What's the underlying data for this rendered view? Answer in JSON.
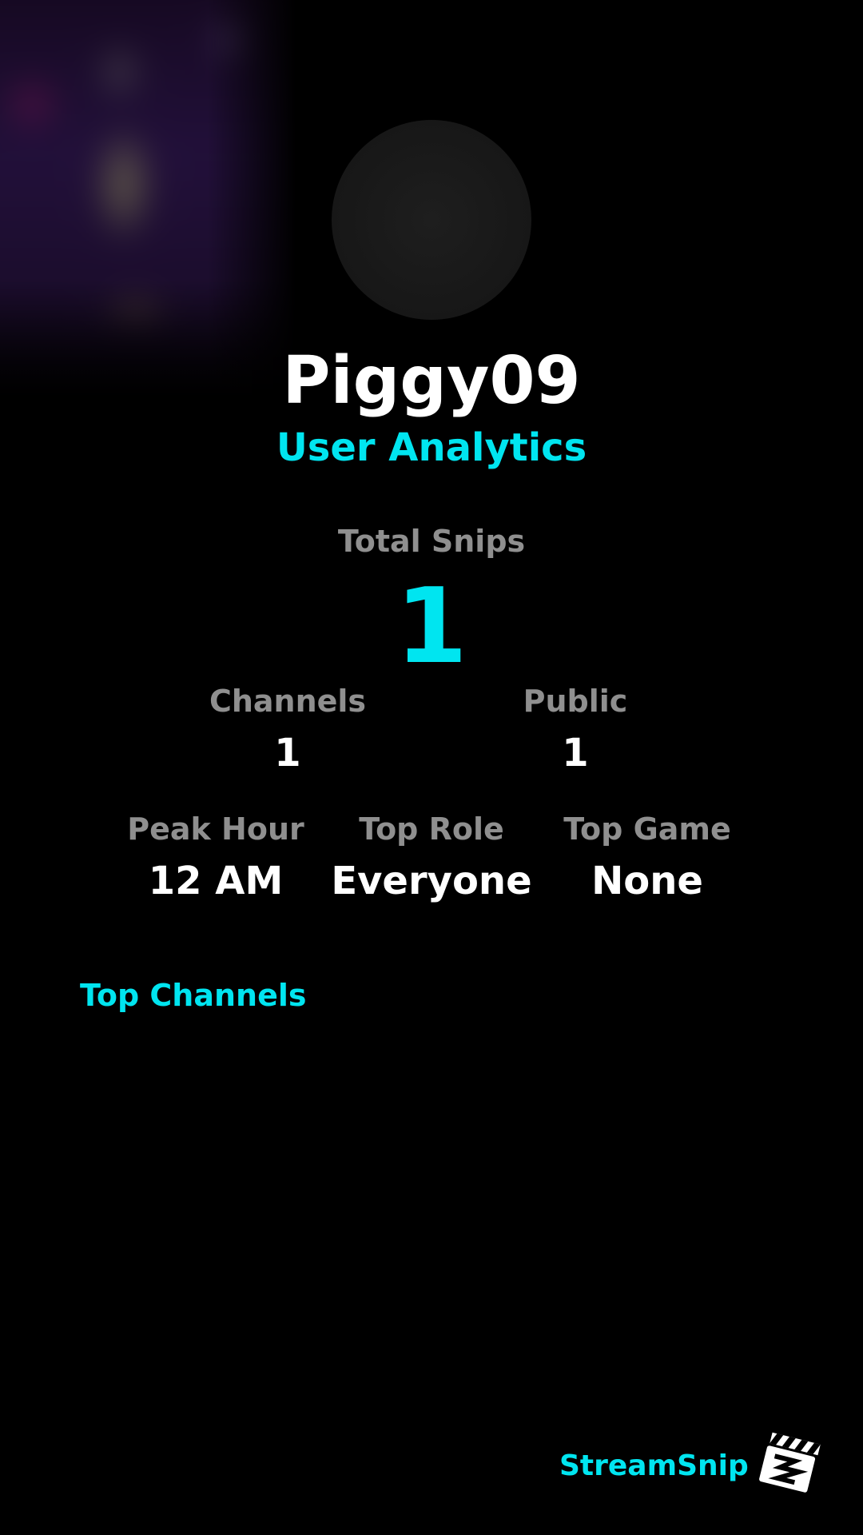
{
  "profile": {
    "username": "Piggy09",
    "subtitle": "User Analytics"
  },
  "stats": {
    "total_snips": {
      "label": "Total Snips",
      "value": "1"
    },
    "channels": {
      "label": "Channels",
      "value": "1"
    },
    "public": {
      "label": "Public",
      "value": "1"
    },
    "peak_hour": {
      "label": "Peak Hour",
      "value": "12 AM"
    },
    "top_role": {
      "label": "Top Role",
      "value": "Everyone"
    },
    "top_game": {
      "label": "Top Game",
      "value": "None"
    }
  },
  "sections": {
    "top_channels_title": "Top Channels"
  },
  "footer": {
    "brand": "StreamSnip",
    "logo_icon": "clapperboard-icon"
  },
  "colors": {
    "accent": "#00e5f0",
    "label": "#8f8f8f",
    "background": "#000000",
    "text": "#ffffff"
  }
}
